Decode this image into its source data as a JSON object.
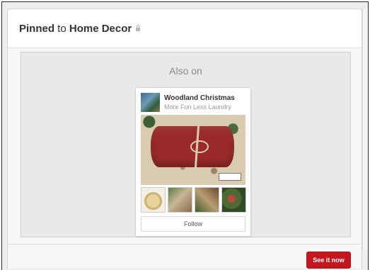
{
  "header": {
    "title_prefix": "Pinned",
    "title_connector": " to ",
    "board_name": "Home Decor",
    "lock_icon": "lock-icon"
  },
  "also_on": {
    "label": "Also on",
    "board": {
      "name": "Woodland Christmas",
      "owner": "More Fun Less Laundry",
      "follow_label": "Follow"
    }
  },
  "actions": {
    "see_it_now": "See it now"
  },
  "colors": {
    "primary_button": "#c4161c",
    "header_text": "#333333",
    "muted_text": "#8a8a8a"
  }
}
